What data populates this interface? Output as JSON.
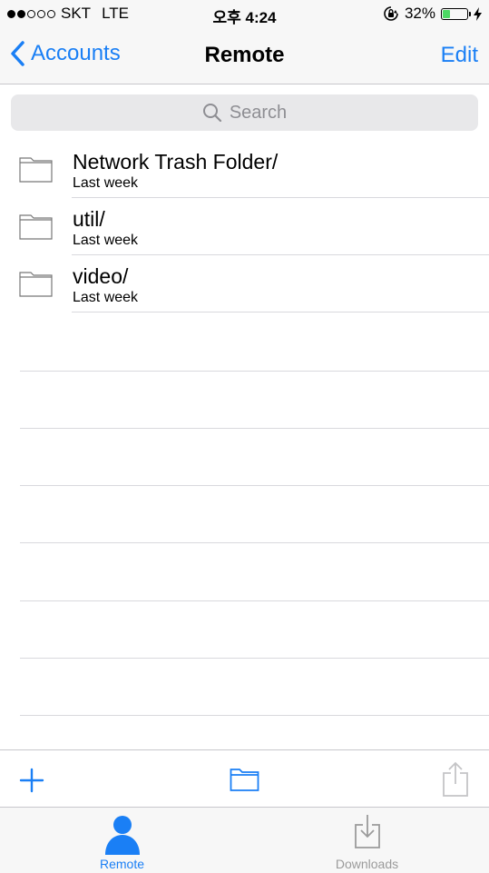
{
  "status_bar": {
    "carrier": "SKT",
    "network": "LTE",
    "time": "오후 4:24",
    "battery_percent": "32%",
    "battery_level": 0.32,
    "signal_strength_bars": 2,
    "signal_total_bars": 5
  },
  "nav": {
    "back_label": "Accounts",
    "title": "Remote",
    "edit_label": "Edit"
  },
  "search": {
    "placeholder": "Search"
  },
  "files": [
    {
      "name": "Network Trash Folder/",
      "modified": "Last week"
    },
    {
      "name": "util/",
      "modified": "Last week"
    },
    {
      "name": "video/",
      "modified": "Last week"
    }
  ],
  "toolbar": {
    "add_icon": "plus-icon",
    "folder_icon": "folder-icon",
    "share_icon": "share-icon"
  },
  "tabs": [
    {
      "label": "Remote",
      "icon": "person-icon",
      "active": true
    },
    {
      "label": "Downloads",
      "icon": "download-tray-icon",
      "active": false
    }
  ],
  "colors": {
    "accent": "#1a7ff5",
    "battery": "#4cd964",
    "inactive": "#9b9b9b"
  }
}
